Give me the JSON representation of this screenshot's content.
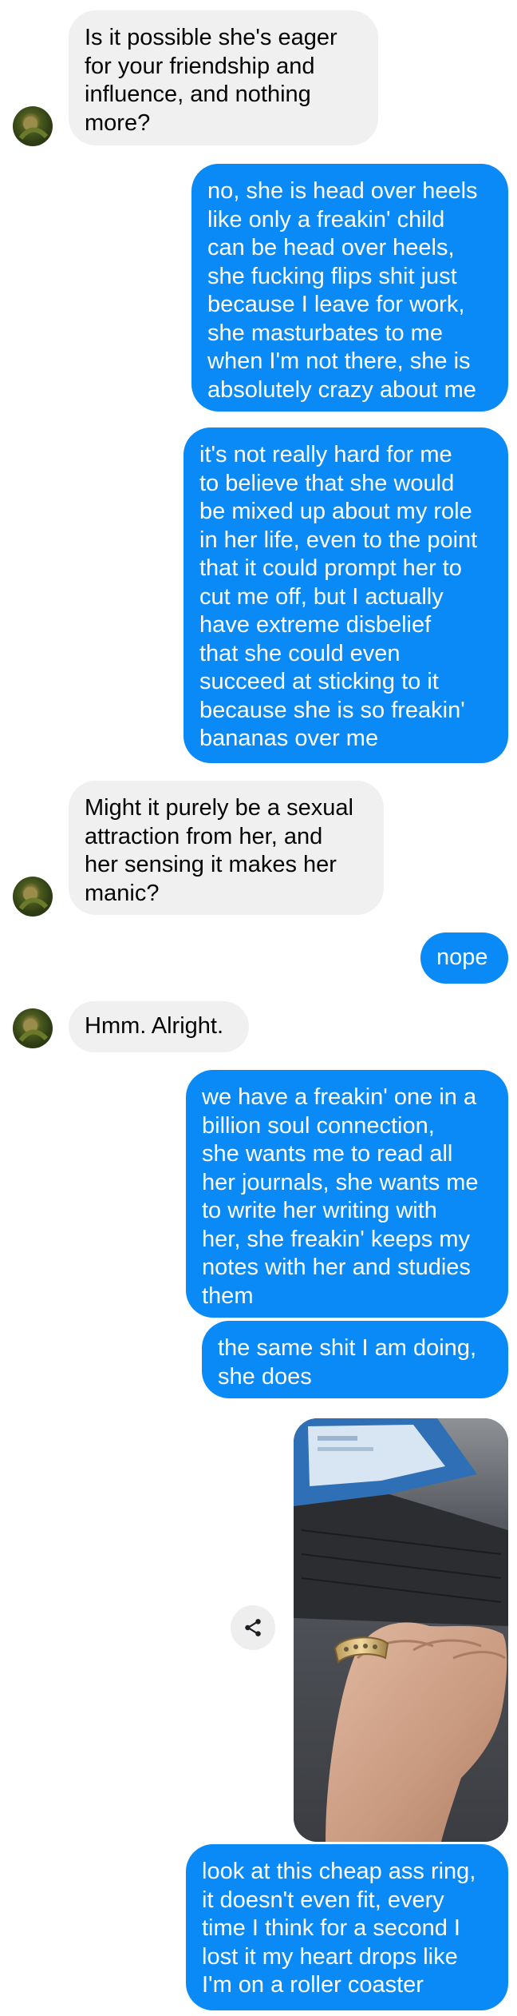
{
  "messages": [
    {
      "text": "Is it possible she's eager\nfor your friendship and\ninfluence, and nothing\nmore?"
    },
    {
      "text": "no, she is head over heels\nlike only a freakin' child\ncan be head over heels,\nshe fucking flips shit just\nbecause I leave for work,\nshe masturbates to me\nwhen I'm not there, she is\nabsolutely crazy about me"
    },
    {
      "text": "it's not really hard for me\nto believe that she would\nbe mixed up about my role\nin her life, even to the point\nthat it could prompt her to\ncut me off, but I actually\nhave extreme disbelief\nthat she could even\nsucceed at sticking to it\nbecause she is so freakin'\nbananas over me"
    },
    {
      "text": "Might it purely be a sexual\nattraction from her, and\nher sensing it makes her\nmanic?"
    },
    {
      "text": "nope"
    },
    {
      "text": "Hmm. Alright."
    },
    {
      "text": "we have a freakin' one in a\nbillion soul connection,\nshe wants me to read all\nher journals, she wants me\nto write her writing with\nher, she freakin' keeps my\nnotes with her and studies\nthem"
    },
    {
      "text": "the same shit I am doing,\nshe does"
    },
    {
      "text": "look at this cheap ass ring,\nit doesn't even fit, every\ntime I think for a second I\nlost it my heart drops like\nI'm on a roller coaster"
    }
  ],
  "colors": {
    "outgoing_bubble": "#0a8af6",
    "incoming_bubble": "#f0f0f0",
    "outgoing_text": "#ffffff",
    "incoming_text": "#050505"
  },
  "icons": {
    "share": "share-icon",
    "avatar": "contact-avatar"
  }
}
